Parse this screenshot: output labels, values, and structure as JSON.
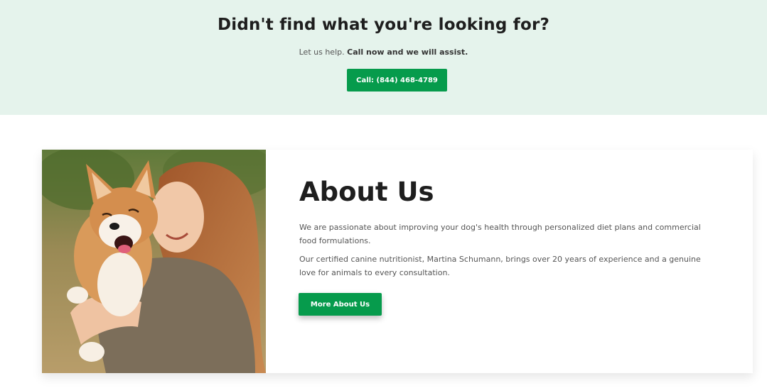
{
  "cta": {
    "heading": "Didn't find what you're looking for?",
    "sub_text": "Let us help.",
    "sub_bold": "Call now and we will assist.",
    "call_button": "Call: (844) 468-4789"
  },
  "about": {
    "title": "About Us",
    "paragraph1": "We are passionate about improving your dog's health through personalized diet plans and commercial food formulations.",
    "paragraph2": "Our certified canine nutritionist, Martina Schumann, brings over 20 years of experience and a genuine love for animals to every consultation.",
    "button": "More About Us",
    "photo_icon": "woman-hugging-corgi-image"
  },
  "colors": {
    "accent_green": "#069b4c",
    "cta_background": "#e5f3ec"
  }
}
